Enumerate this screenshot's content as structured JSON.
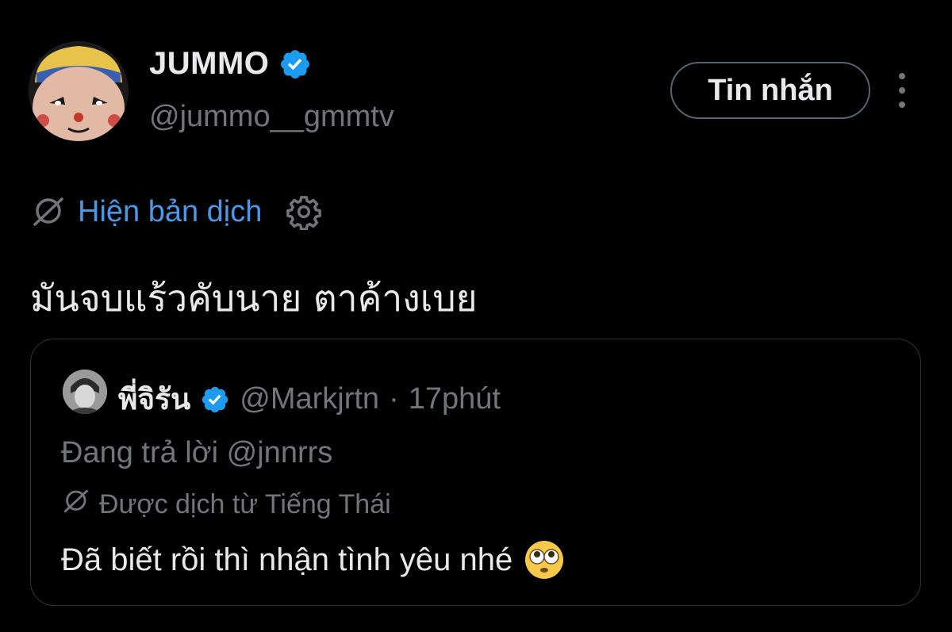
{
  "profile": {
    "display_name": "JUMMO",
    "handle": "@jummo__gmmtv",
    "verified": true
  },
  "actions": {
    "message_label": "Tin nhắn",
    "more_icon": "more-vertical-icon"
  },
  "translation": {
    "show_label": "Hiện bản dịch",
    "icon": "translate-icon",
    "settings_icon": "gear-icon"
  },
  "tweet": {
    "text": "มันจบแร้วคับนาย ตาค้างเบย"
  },
  "quote": {
    "display_name": "พี่จิรัน",
    "handle": "@Markjrtn",
    "separator": "·",
    "time": "17phút",
    "reply_to": "Đang trả lời @jnnrrs",
    "translated_from": "Được dịch từ Tiếng Thái",
    "text": "Đã biết rồi thì nhận tình yêu nhé",
    "emoji": "flushed-eyes-emoji"
  },
  "colors": {
    "background": "#000000",
    "text": "#e7e9ea",
    "muted": "#71767b",
    "link": "#4a99e9",
    "verified": "#1d9bf0",
    "border": "#2f3336"
  }
}
